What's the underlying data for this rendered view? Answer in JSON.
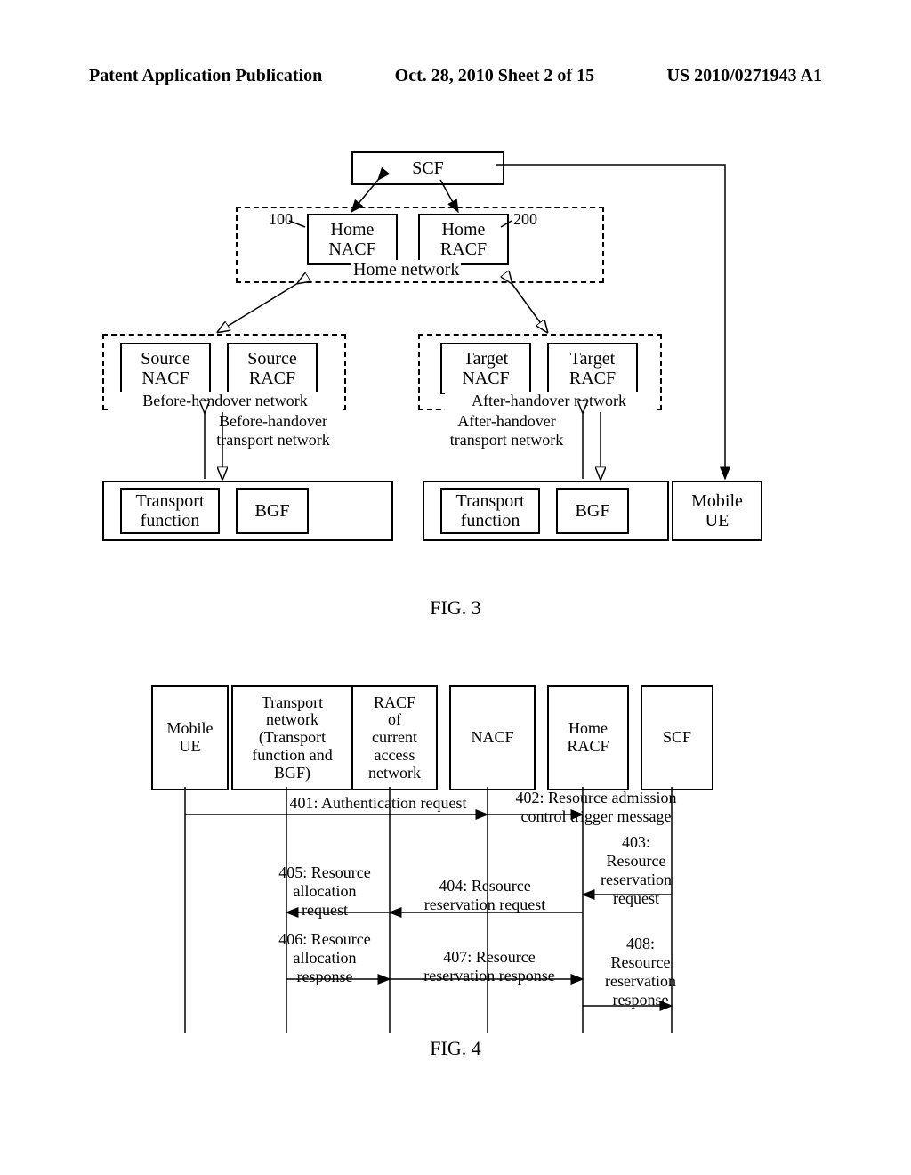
{
  "header": {
    "left": "Patent Application Publication",
    "center": "Oct. 28, 2010  Sheet 2 of 15",
    "right": "US 2010/0271943 A1"
  },
  "fig3": {
    "scf": "SCF",
    "home_nacf": "Home\nNACF",
    "home_racf": "Home\nRACF",
    "home_network_label": "Home network",
    "ref100": "100",
    "ref200": "200",
    "source_nacf": "Source\nNACF",
    "source_racf": "Source\nRACF",
    "before_label": "Before-handover network",
    "target_nacf": "Target\nNACF",
    "target_racf": "Target\nRACF",
    "after_label": "After-handover network",
    "before_transport": "Before-handover\ntransport network",
    "after_transport": "After-handover\ntransport network",
    "transport_func_left": "Transport\nfunction",
    "bgf_left": "BGF",
    "transport_func_right": "Transport\nfunction",
    "bgf_right": "BGF",
    "mobile_ue": "Mobile\nUE",
    "caption": "FIG. 3"
  },
  "fig4": {
    "heads": {
      "mobile_ue": "Mobile\nUE",
      "transport": "Transport\nnetwork\n(Transport\nfunction and\nBGF)",
      "racf_current": "RACF\nof\ncurrent\naccess\nnetwork",
      "nacf": "NACF",
      "home_racf": "Home\nRACF",
      "scf": "SCF"
    },
    "msg": {
      "m401": "401: Authentication request",
      "m402": "402: Resource admission\ncontrol trigger message",
      "m403": "403:\nResource\nreservation\nrequest",
      "m404": "404: Resource\nreservation request",
      "m405": "405: Resource\nallocation\nrequest",
      "m406": "406: Resource\nallocation\nresponse",
      "m407": "407: Resource\nreservation response",
      "m408": "408:\nResource\nreservation\nresponse"
    },
    "caption": "FIG. 4"
  }
}
